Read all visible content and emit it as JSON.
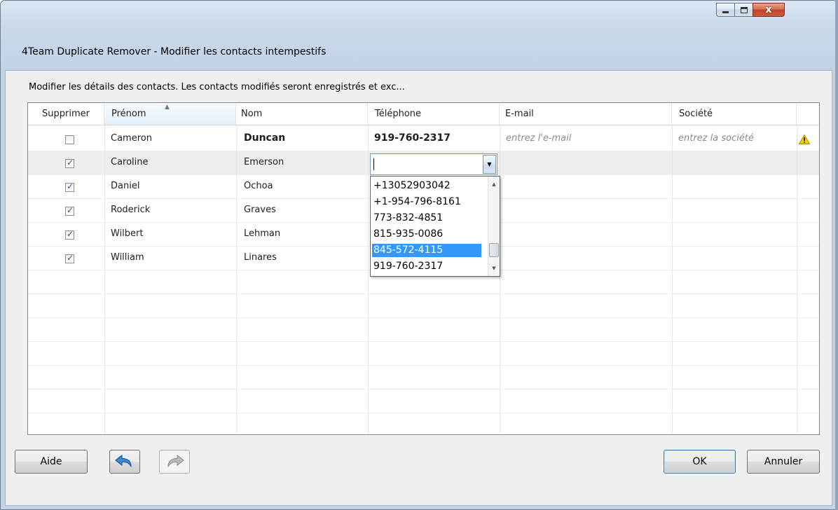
{
  "window": {
    "title": "4Team Duplicate Remover - Modifier les contacts intempestifs",
    "close_label": "x"
  },
  "instructions": "Modifier les détails des contacts. Les contacts modifiés seront enregistrés et exc...",
  "grid": {
    "headers": {
      "delete": "Supprimer",
      "first": "Prénom",
      "last": "Nom",
      "phone": "Téléphone",
      "email": "E-mail",
      "company": "Société"
    },
    "rows": [
      {
        "checked": false,
        "first": "Cameron",
        "last": "Duncan",
        "phone": "919-760-2317",
        "email": "entrez l'e-mail",
        "company": "entrez la société"
      },
      {
        "checked": true,
        "first": "Caroline",
        "last": "Emerson"
      },
      {
        "checked": true,
        "first": "Daniel",
        "last": "Ochoa"
      },
      {
        "checked": true,
        "first": "Roderick",
        "last": "Graves"
      },
      {
        "checked": true,
        "first": "Wilbert",
        "last": "Lehman"
      },
      {
        "checked": true,
        "first": "William",
        "last": "Linares"
      }
    ]
  },
  "phone_dropdown": {
    "options": [
      "+13052903042",
      "+1-954-796-8161",
      "773-832-4851",
      "815-935-0086",
      "845-572-4115",
      "919-760-2317"
    ],
    "selected_index": 4
  },
  "buttons": {
    "help": "Aide",
    "ok": "OK",
    "cancel": "Annuler"
  },
  "colors": {
    "selection": "#3399ff",
    "warning": "#f5d200"
  }
}
